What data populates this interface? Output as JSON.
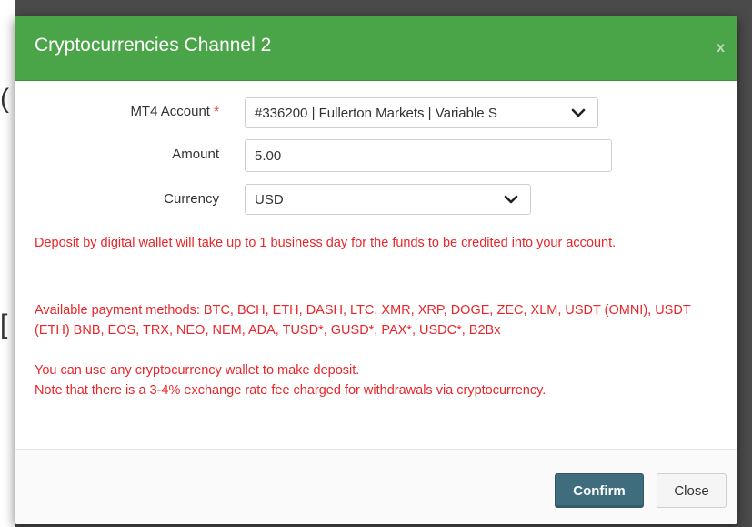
{
  "modal": {
    "title": "Cryptocurrencies Channel 2",
    "close_glyph": "x"
  },
  "form": {
    "account": {
      "label": "MT4 Account",
      "required_mark": "*",
      "value": "#336200 | Fullerton Markets | Variable S"
    },
    "amount": {
      "label": "Amount",
      "value": "5.00"
    },
    "currency": {
      "label": "Currency",
      "value": "USD"
    }
  },
  "notice": {
    "line1": "Deposit by digital wallet will take up to 1 business day for the funds to be credited into your account.",
    "methods": "Available payment methods: BTC, BCH, ETH, DASH, LTC, XMR, XRP, DOGE, ZEC, XLM, USDT (OMNI), USDT (ETH) BNB, EOS, TRX, NEO, NEM, ADA, TUSD*, GUSD*, PAX*, USDC*, B2Bx",
    "wallet": "You can use any cryptocurrency wallet to make deposit.",
    "fee": "Note that there is a 3-4% exchange rate fee charged for withdrawals via cryptocurrency."
  },
  "footer": {
    "confirm_label": "Confirm",
    "close_label": "Close"
  },
  "colors": {
    "header": "#4aa448",
    "notice": "#e8262a",
    "confirm": "#3f6d7d"
  },
  "backdrop": {
    "glyph_a": "(",
    "glyph_b": "["
  }
}
